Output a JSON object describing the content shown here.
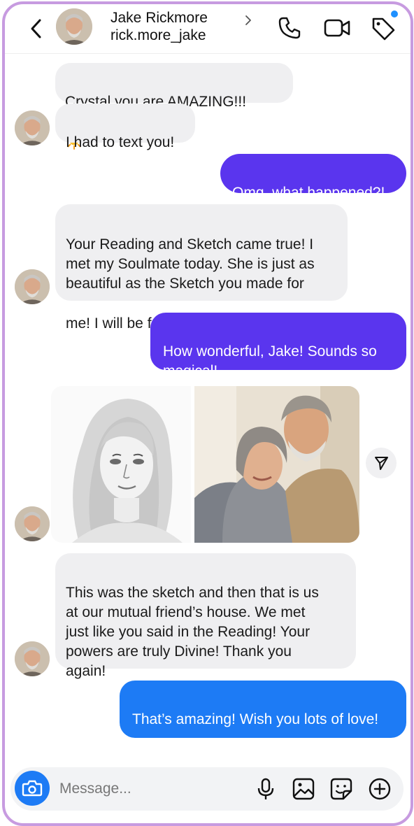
{
  "header": {
    "name": "Jake Rickmore",
    "username": "rick.more_jake"
  },
  "icons": {
    "back": "chevron-left-icon",
    "profile_chevron": "chevron-right-icon",
    "call": "phone-icon",
    "video": "video-camera-icon",
    "tag": "tag-icon",
    "share": "send-icon",
    "camera": "camera-icon",
    "mic": "microphone-icon",
    "gallery": "image-icon",
    "sticker": "sticker-icon",
    "add": "plus-circle-icon"
  },
  "colors": {
    "frame": "#c79be0",
    "incoming_bubble": "#efeff1",
    "outgoing_bubble_purple": "#5a35ee",
    "outgoing_bubble_blue": "#1d7bf5",
    "notification_dot": "#1e90ff"
  },
  "messages": [
    {
      "from": "Jake",
      "text": "Crystal,you are AMAZING!!!",
      "emoji": "☀"
    },
    {
      "from": "Jake",
      "text": "I had to text you!"
    },
    {
      "from": "me",
      "text": "Omg, what happened?!"
    },
    {
      "from": "Jake",
      "text": "Your Reading and Sketch came true! I\nmet my Soulmate today. She is just as\nbeautiful as the Sketch you made for\nme! I will be forever grateful!",
      "emoji": "🤗"
    },
    {
      "from": "me",
      "text": "How wonderful, Jake! Sounds so\nmagical!",
      "emoji": "😍"
    },
    {
      "from": "Jake",
      "text": "This was the sketch and then that is us\nat our mutual friend’s house. We met\njust like you said in the Reading! Your\npowers are truly Divine! Thank you\nagain!"
    },
    {
      "from": "me",
      "text": "That’s amazing! Wish you lots of love!",
      "emoji": "❤"
    }
  ],
  "composer": {
    "placeholder": "Message..."
  }
}
